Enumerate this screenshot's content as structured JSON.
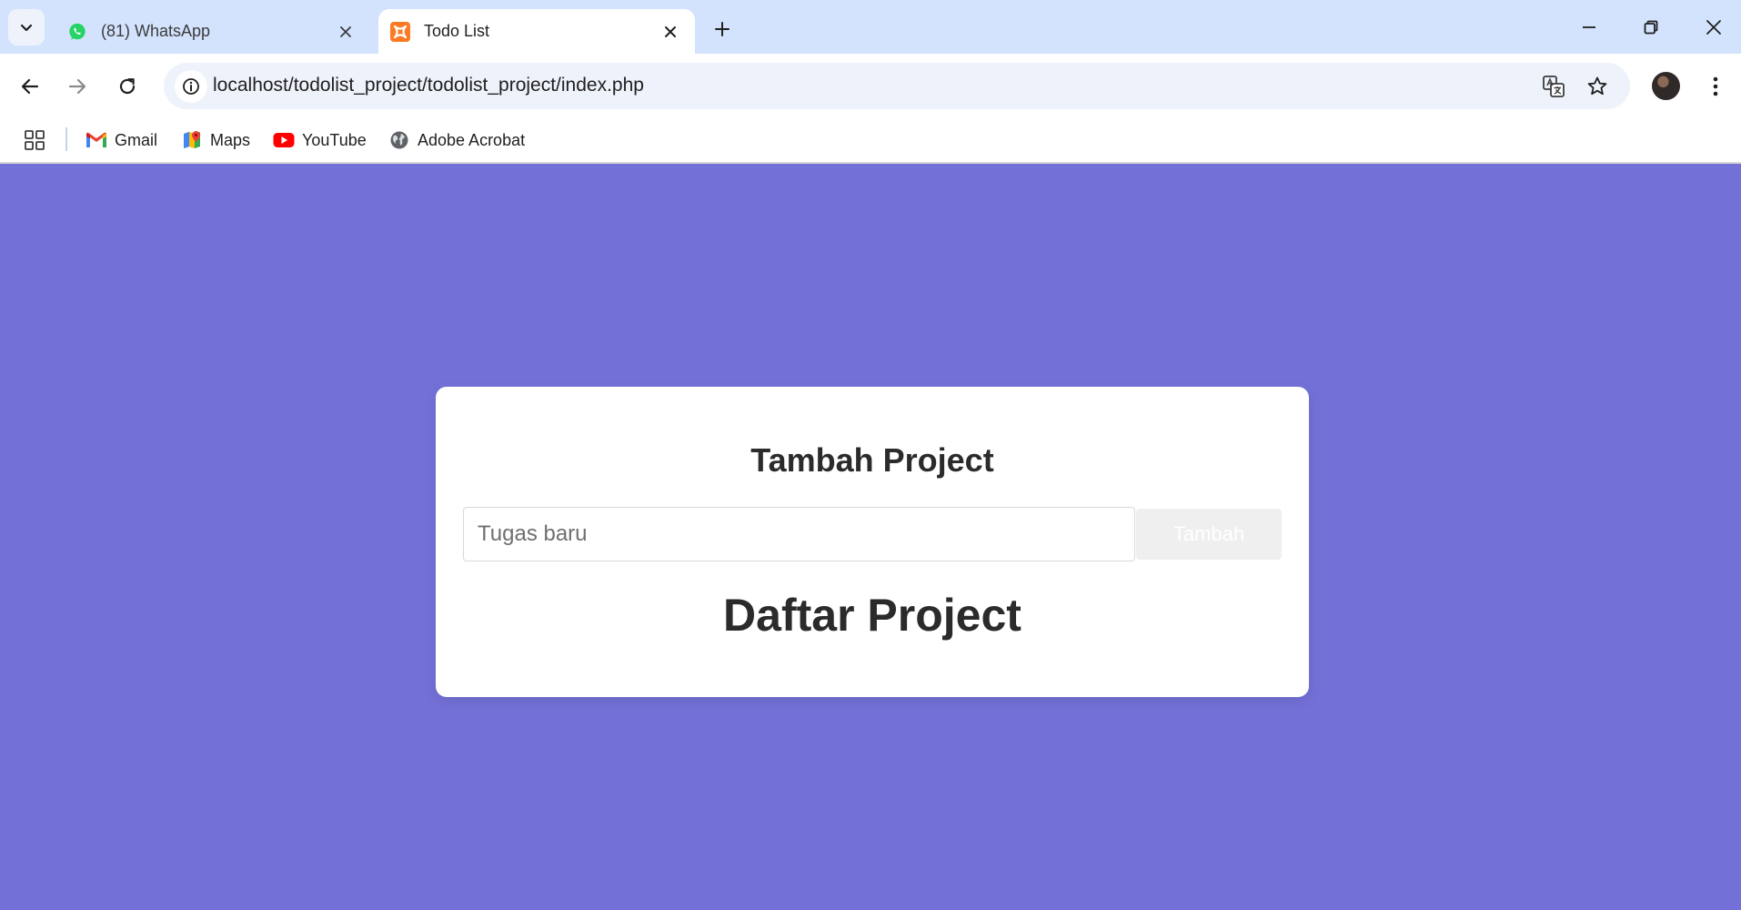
{
  "browser": {
    "tabs": [
      {
        "title": "(81) WhatsApp",
        "icon": "whatsapp-icon",
        "active": false
      },
      {
        "title": "Todo List",
        "icon": "xampp-icon",
        "active": true
      }
    ],
    "url": "localhost/todolist_project/todolist_project/index.php",
    "bookmarks": [
      {
        "label": "Gmail",
        "icon": "gmail-icon"
      },
      {
        "label": "Maps",
        "icon": "maps-icon"
      },
      {
        "label": "YouTube",
        "icon": "youtube-icon"
      },
      {
        "label": "Adobe Acrobat",
        "icon": "globe-icon"
      }
    ]
  },
  "page": {
    "background_color": "#7371d7",
    "add_heading": "Tambah Project",
    "task_input": {
      "placeholder": "Tugas baru",
      "value": ""
    },
    "add_button_label": "Tambah",
    "list_heading": "Daftar Project"
  }
}
